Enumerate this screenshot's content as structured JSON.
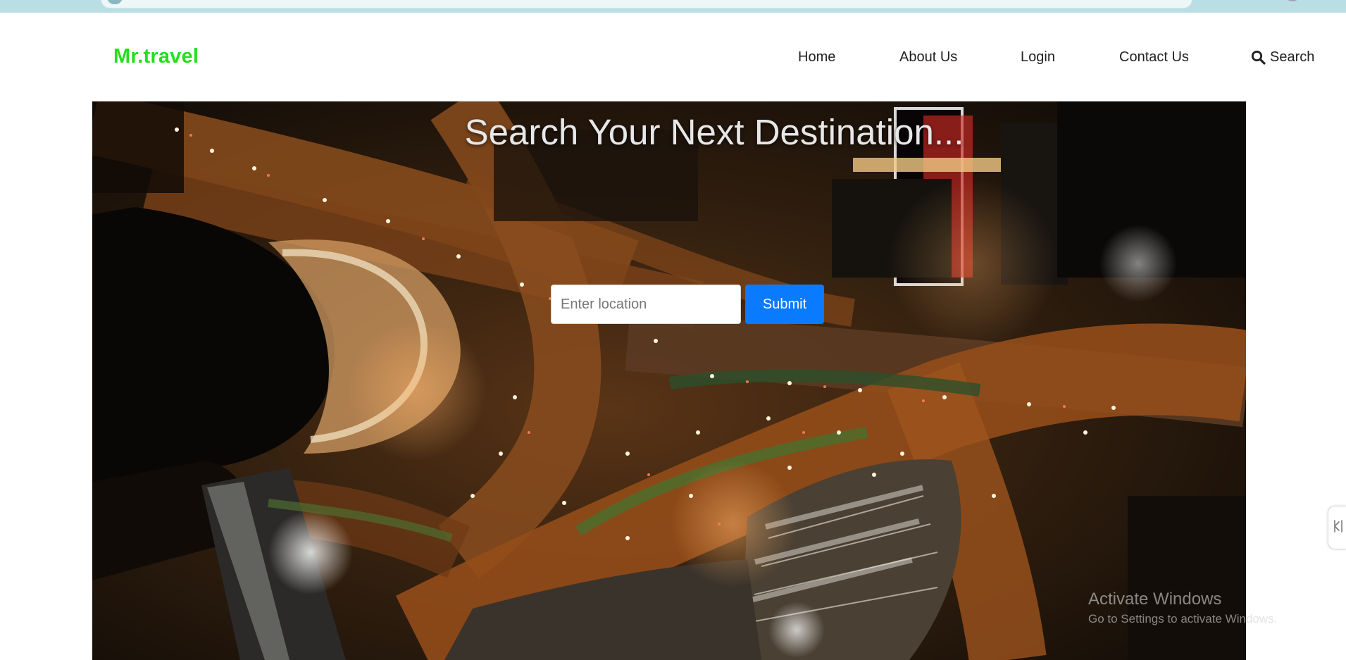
{
  "brand": {
    "name": "Mr.travel",
    "color": "#22e01c"
  },
  "nav": {
    "items": [
      {
        "label": "Home"
      },
      {
        "label": "About Us"
      },
      {
        "label": "Login"
      },
      {
        "label": "Contact Us"
      }
    ],
    "search": {
      "label": "Search",
      "icon": "search-icon"
    }
  },
  "hero": {
    "title": "Search Your Next Destination...",
    "background": "night aerial city road photo"
  },
  "search_form": {
    "location_placeholder": "Enter location",
    "location_value": "",
    "submit_label": "Submit",
    "submit_color": "#0a7bff"
  },
  "system_overlay": {
    "activation_title": "Activate Windows",
    "activation_subtitle": "Go to Settings to activate Windows."
  },
  "colors": {
    "browser_strip": "#b9dfe5",
    "page_background": "#ffffff"
  }
}
